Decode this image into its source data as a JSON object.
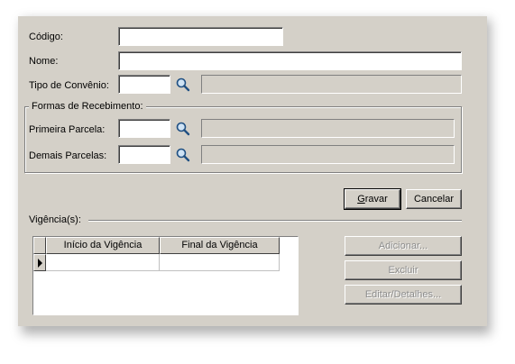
{
  "form": {
    "codigo_label": "Código:",
    "codigo_value": "",
    "nome_label": "Nome:",
    "nome_value": "",
    "tipo_label": "Tipo de Convênio:",
    "tipo_value": "",
    "tipo_desc": ""
  },
  "recebimento": {
    "title": "Formas de Recebimento:",
    "primeira_label": "Primeira Parcela:",
    "primeira_value": "",
    "primeira_desc": "",
    "demais_label": "Demais Parcelas:",
    "demais_value": "",
    "demais_desc": ""
  },
  "actions": {
    "gravar_label": "Gravar",
    "gravar_accel": "G",
    "gravar_rest": "ravar",
    "cancelar_label": "Cancelar"
  },
  "vigencia": {
    "title": "Vigência(s):",
    "columns": [
      "Início da Vigência",
      "Final da Vigência"
    ],
    "rows": [
      [
        "",
        ""
      ]
    ]
  },
  "vigencia_buttons": {
    "adicionar": "Adicionar...",
    "excluir": "Excluir",
    "editar": "Editar/Detalhes..."
  },
  "icons": {
    "lookup": "magnifier-icon"
  }
}
